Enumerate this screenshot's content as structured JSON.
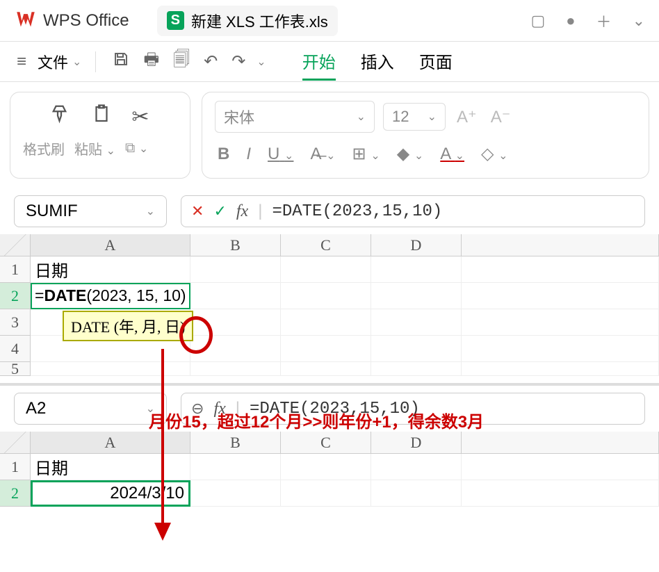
{
  "title_bar": {
    "app_name": "WPS Office",
    "doc_tab_icon": "S",
    "doc_tab_label": "新建 XLS 工作表.xls"
  },
  "menu": {
    "file_label": "文件",
    "tabs": {
      "start": "开始",
      "insert": "插入",
      "page": "页面"
    }
  },
  "ribbon": {
    "group1": {
      "brush": "格式刷",
      "paste": "粘贴"
    },
    "font": {
      "name": "宋体",
      "size": "12"
    },
    "fmt": {
      "B": "B",
      "I": "I",
      "U": "U",
      "A": "A"
    }
  },
  "view1": {
    "name_box": "SUMIF",
    "fx_label": "fx",
    "formula": "=DATE(2023,15,10)",
    "cols": {
      "A": "A",
      "B": "B",
      "C": "C",
      "D": "D"
    },
    "rows": {
      "r1": {
        "n": "1",
        "A": "日期"
      },
      "r2": {
        "n": "2",
        "A_pre": "=",
        "A_fn": "DATE",
        "A_args": "(2023, 15, 10)"
      },
      "r3": {
        "n": "3"
      },
      "r4": {
        "n": "4"
      },
      "r5": {
        "n": "5"
      }
    },
    "tooltip": "DATE (年, 月, 日)"
  },
  "annotation": {
    "text": "月份15，超过12个月>>则年份+1，得余数3月"
  },
  "view2": {
    "name_box": "A2",
    "fx_label": "fx",
    "formula": "=DATE(2023,15,10)",
    "cols": {
      "A": "A",
      "B": "B",
      "C": "C",
      "D": "D"
    },
    "rows": {
      "r1": {
        "n": "1",
        "A": "日期"
      },
      "r2": {
        "n": "2",
        "A": "2024/3/10"
      }
    }
  }
}
